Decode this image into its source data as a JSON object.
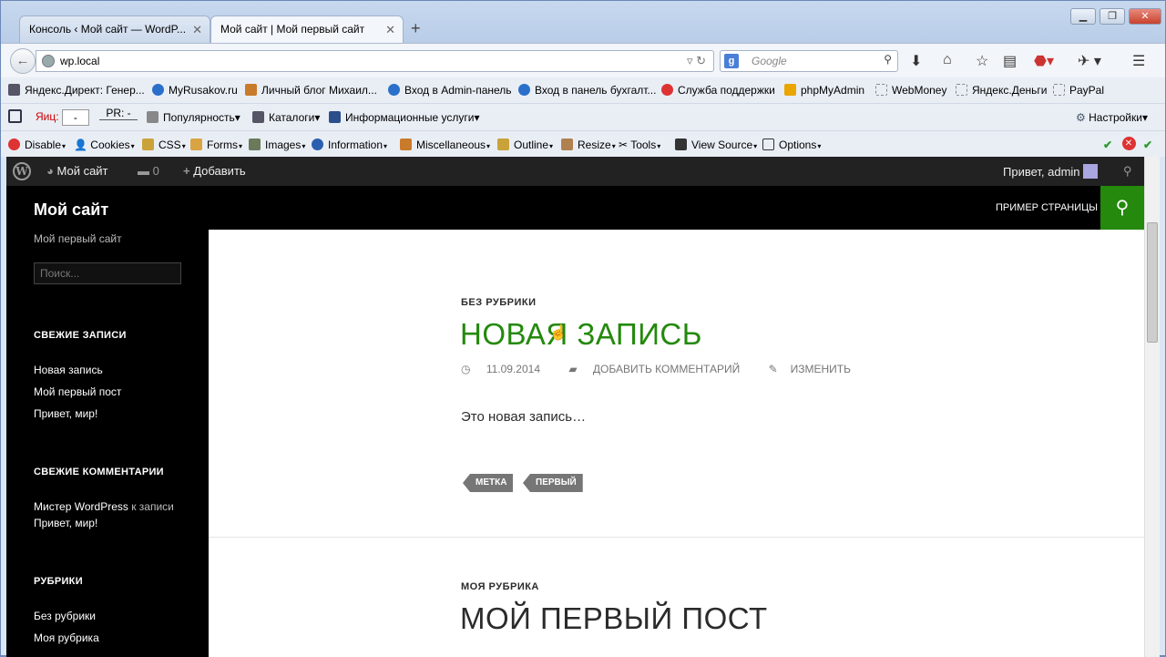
{
  "tabs": [
    {
      "label": "Консоль ‹ Мой сайт — WordP..."
    },
    {
      "label": "Мой сайт | Мой первый сайт"
    }
  ],
  "nav": {
    "url": "wp.local",
    "search_placeholder": "Google"
  },
  "bookmarks": [
    "Яндекс.Директ: Генер...",
    "MyRusakov.ru",
    "Личный блог Михаил...",
    "Вход в Admin-панель",
    "Вход в панель бухгалт...",
    "Служба поддержки",
    "phpMyAdmin",
    "WebMoney",
    "Яндекс.Деньги",
    "PayPal"
  ],
  "yandex_bar": {
    "tic_label": "Яиц:",
    "tic_value": "-",
    "pr_label": "PR: -",
    "items": [
      "Популярность",
      "Каталоги",
      "Информационные услуги"
    ],
    "settings": "Настройки"
  },
  "webdev_bar": [
    "Disable",
    "Cookies",
    "CSS",
    "Forms",
    "Images",
    "Information",
    "Miscellaneous",
    "Outline",
    "Resize",
    "Tools",
    "View Source",
    "Options"
  ],
  "admin_bar": {
    "site": "Мой сайт",
    "comments": "0",
    "add": "Добавить",
    "greeting": "Привет, admin"
  },
  "site": {
    "title": "Мой сайт",
    "tagline": "Мой первый сайт",
    "menu": "ПРИМЕР СТРАНИЦЫ",
    "search_placeholder": "Поиск..."
  },
  "sidebar": {
    "recent_posts_title": "СВЕЖИЕ ЗАПИСИ",
    "recent_posts": [
      "Новая запись",
      "Мой первый пост",
      "Привет, мир!"
    ],
    "recent_comments_title": "СВЕЖИЕ КОММЕНТАРИИ",
    "comment_author": "Мистер WordPress",
    "comment_on": "к записи",
    "comment_post": "Привет, мир!",
    "categories_title": "РУБРИКИ",
    "categories": [
      "Без рубрики",
      "Моя рубрика"
    ]
  },
  "posts": [
    {
      "category": "БЕЗ РУБРИКИ",
      "title": "НОВАЯ ЗАПИСЬ",
      "date": "11.09.2014",
      "comment": "ДОБАВИТЬ КОММЕНТАРИЙ",
      "edit": "ИЗМЕНИТЬ",
      "excerpt": "Это новая запись…",
      "tags": [
        "МЕТКА",
        "ПЕРВЫЙ"
      ]
    },
    {
      "category": "МОЯ РУБРИКА",
      "title": "МОЙ ПЕРВЫЙ ПОСТ"
    }
  ],
  "colors": {
    "accent": "#24890d",
    "admin_bar": "#222222",
    "sidebar": "#000000"
  }
}
